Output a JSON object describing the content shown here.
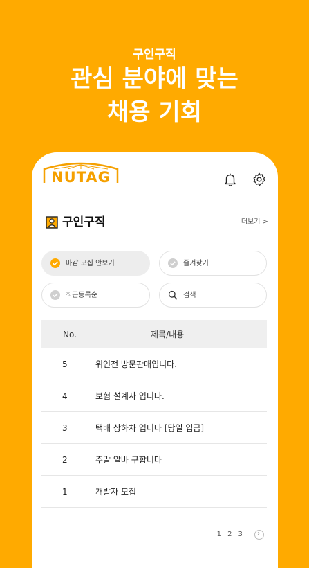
{
  "promo": {
    "eyebrow": "구인구직",
    "title_line1": "관심 분야에 맞는",
    "title_line2": "채용 기회"
  },
  "app": {
    "logo_text": "NUTAG",
    "brand_color": "#FFAA00"
  },
  "section": {
    "title": "구인구직",
    "more_label": "더보기 >"
  },
  "filters": [
    {
      "label": "마감 모집 안보기",
      "active": true
    },
    {
      "label": "즐겨찾기",
      "active": false
    },
    {
      "label": "최근등록순",
      "active": false
    },
    {
      "label": "검색",
      "active": false
    }
  ],
  "table": {
    "headers": [
      "No.",
      "제목/내용"
    ],
    "rows": [
      {
        "no": "5",
        "title": "위인전 방문판매입니다."
      },
      {
        "no": "4",
        "title": "보험 설계사 입니다."
      },
      {
        "no": "3",
        "title": "택배 상하차 입니다 [당일 입금]"
      },
      {
        "no": "2",
        "title": "주말 알바 구합니다"
      },
      {
        "no": "1",
        "title": "개발자 모집"
      }
    ]
  },
  "pagination": {
    "pages": [
      "1",
      "2",
      "3"
    ]
  }
}
